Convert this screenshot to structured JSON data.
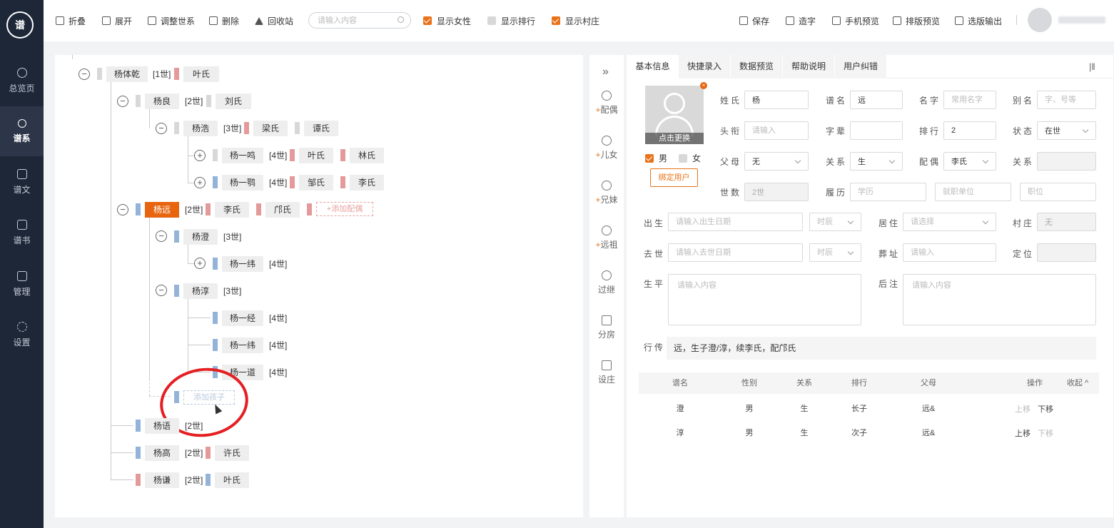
{
  "sidebar": {
    "logo": "谱",
    "items": [
      {
        "label": "总览页",
        "icon": "pie-chart-icon"
      },
      {
        "label": "谱系",
        "icon": "family-tree-icon"
      },
      {
        "label": "谱文",
        "icon": "document-icon"
      },
      {
        "label": "谱书",
        "icon": "book-icon"
      },
      {
        "label": "管理",
        "icon": "grid-icon"
      },
      {
        "label": "设置",
        "icon": "gear-icon"
      }
    ]
  },
  "toolbar": {
    "fold": "折叠",
    "expand": "展开",
    "adjust": "调整世系",
    "delete": "删除",
    "recycle": "回收站",
    "search_placeholder": "请输入内容",
    "show_female": "显示女性",
    "show_rank": "显示排行",
    "show_village": "显示村庄",
    "save": "保存",
    "make_char": "造字",
    "mobile_preview": "手机预览",
    "layout_preview": "排版预览",
    "export": "选版输出"
  },
  "tree": {
    "root": {
      "name": "杨体乾",
      "gen": "[1世]",
      "spouse": "叶氏"
    },
    "nodes": [
      {
        "name": "杨良",
        "gen": "[2世]",
        "spouses": [
          "刘氏"
        ]
      },
      {
        "name": "杨浩",
        "gen": "[3世]",
        "spouses": [
          "梁氏",
          "谭氏"
        ]
      },
      {
        "name": "杨一鸣",
        "gen": "[4世]",
        "spouses": [
          "叶氏",
          "林氏"
        ]
      },
      {
        "name": "杨一鹗",
        "gen": "[4世]",
        "spouses": [
          "邹氏",
          "李氏"
        ]
      },
      {
        "name": "杨远",
        "gen": "[2世]",
        "spouses": [
          "李氏",
          "邝氏"
        ]
      },
      {
        "name": "杨澄",
        "gen": "[3世]",
        "spouses": []
      },
      {
        "name": "杨一纬",
        "gen": "[4世]",
        "spouses": []
      },
      {
        "name": "杨淳",
        "gen": "[3世]",
        "spouses": []
      },
      {
        "name": "杨一经",
        "gen": "[4世]",
        "spouses": []
      },
      {
        "name": "杨一纬",
        "gen": "[4世]",
        "spouses": []
      },
      {
        "name": "杨一道",
        "gen": "[4世]",
        "spouses": []
      },
      {
        "name": "杨语",
        "gen": "[2世]",
        "spouses": []
      },
      {
        "name": "杨高",
        "gen": "[2世]",
        "spouses": [
          "许氏"
        ]
      },
      {
        "name": "杨谦",
        "gen": "[2世]",
        "spouses": [
          "叶氏"
        ]
      }
    ],
    "add_spouse": "+添加配偶",
    "add_child": "添加孩子"
  },
  "actions": [
    {
      "label": "配偶",
      "plus": "+"
    },
    {
      "label": "儿女",
      "plus": "+"
    },
    {
      "label": "兄妹",
      "plus": "+"
    },
    {
      "label": "远祖",
      "plus": "+"
    },
    {
      "label": "过继",
      "plus": ""
    },
    {
      "label": "分房",
      "plus": ""
    },
    {
      "label": "设庄",
      "plus": ""
    }
  ],
  "tabs": [
    "基本信息",
    "快捷录入",
    "数据预览",
    "帮助说明",
    "用户纠错"
  ],
  "form": {
    "photo_change": "点击更换",
    "photo_close": "×",
    "male": "男",
    "female": "女",
    "bind_user": "绑定用户",
    "labels": {
      "surname": "姓氏",
      "pu_name": "谱名",
      "given_name": "名字",
      "alias": "别名",
      "title": "头衔",
      "zibei": "字辈",
      "rank": "排行",
      "status": "状态",
      "parents": "父母",
      "relation": "关系",
      "spouse": "配偶",
      "relation2": "关系",
      "gen": "世数",
      "resume": "履历",
      "birth": "出生",
      "residence": "居住",
      "village": "村庄",
      "death": "去世",
      "burial": "葬址",
      "locate": "定位",
      "life": "生平",
      "notes": "后注",
      "biography": "行传"
    },
    "values": {
      "surname": "杨",
      "pu_name": "远",
      "rank": "2",
      "status": "在世",
      "parents": "无",
      "relation": "生",
      "spouse": "李氏",
      "gen": "2世",
      "village": "无"
    },
    "placeholders": {
      "given_name": "常用名字",
      "alias": "字、号等",
      "title": "请输入",
      "education": "学历",
      "employer": "就职单位",
      "position": "职位",
      "birth": "请输入出生日期",
      "hour": "时辰",
      "residence": "请选择",
      "death": "请输入去世日期",
      "burial": "请输入",
      "life": "请输入内容",
      "notes": "请输入内容"
    },
    "biography_text": "远，生子澄/淳，续李氏，配邝氏"
  },
  "table": {
    "headers": [
      "谱名",
      "性别",
      "关系",
      "排行",
      "父母",
      "操作"
    ],
    "collapse": "收起 ^",
    "rows": [
      {
        "name": "澄",
        "gender": "男",
        "relation": "生",
        "rank": "长子",
        "parents": "远&",
        "up": "上移",
        "down": "下移"
      },
      {
        "name": "淳",
        "gender": "男",
        "relation": "生",
        "rank": "次子",
        "parents": "远&",
        "up": "上移",
        "down": "下移"
      }
    ]
  }
}
